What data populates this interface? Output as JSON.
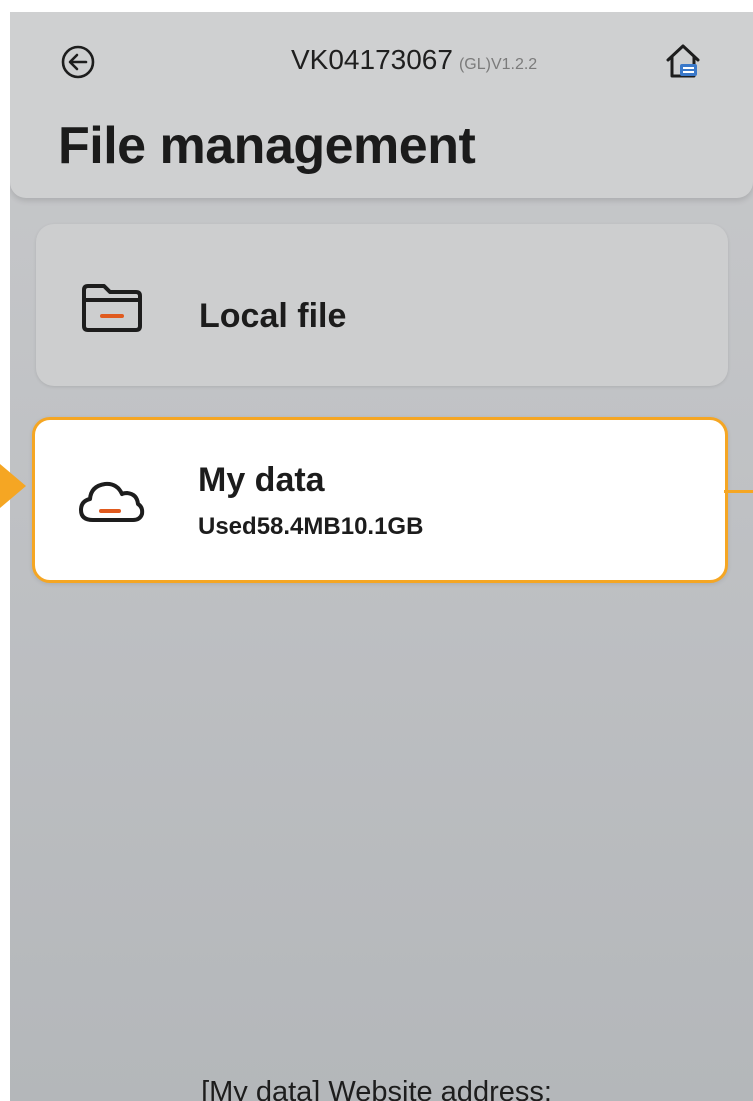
{
  "header": {
    "device_id": "VK04173067",
    "version": "(GL)V1.2.2",
    "title": "File management",
    "back_icon": "back-arrow-circle-icon",
    "home_icon": "home-icon"
  },
  "cards": [
    {
      "label": "Local file",
      "icon": "folder-icon"
    },
    {
      "label": "My data",
      "sub": "Used58.4MB10.1GB",
      "icon": "cloud-icon",
      "highlighted": true
    }
  ],
  "footer": {
    "text": "[My data] Website address:"
  },
  "colors": {
    "accent": "#f5a623",
    "icon_accent": "#e05a1e",
    "background": "#c0c2c5",
    "card": "#cdcecf",
    "highlight_card": "#ffffff"
  }
}
